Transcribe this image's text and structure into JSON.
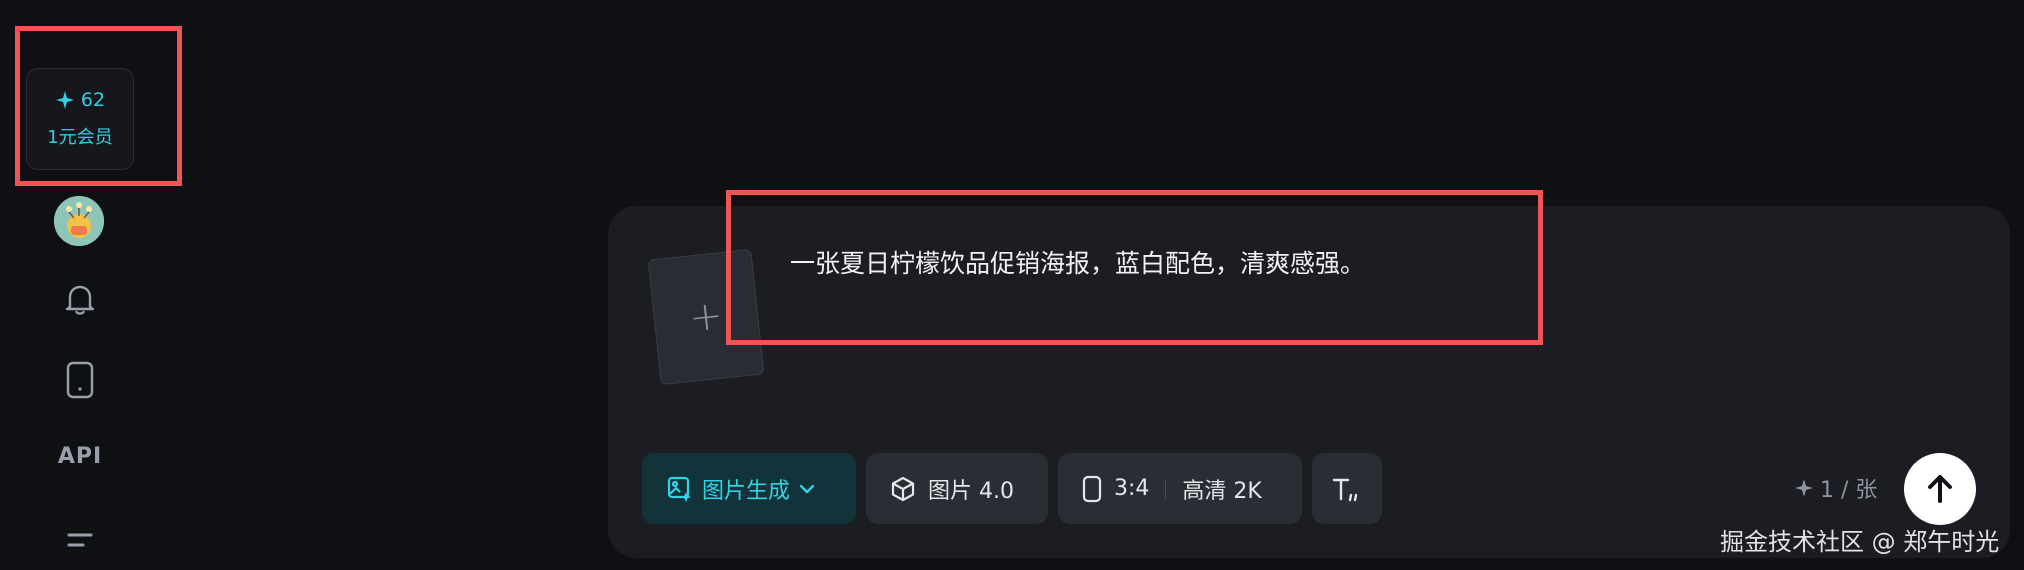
{
  "sidebar": {
    "credits": {
      "count": "62",
      "member_label": "1元会员",
      "accent_color": "#33cfe3"
    },
    "api_label": "API",
    "icons": [
      "user-avatar",
      "bell-icon",
      "device-icon",
      "menu-icon"
    ]
  },
  "composer": {
    "prompt": "一张夏日柠檬饮品促销海报，蓝白配色，清爽感强。",
    "upload_symbol": "+",
    "toolbar": {
      "mode_label": "图片生成",
      "model_label": "图片 4.0",
      "ratio_label": "3:4",
      "quality_label": "高清 2K",
      "cost_label": "1 / 张"
    }
  },
  "watermark": "掘金技术社区 @ 郑午时光",
  "colors": {
    "background": "#0f1014",
    "panel": "#1c1d23",
    "accent": "#2ed3e6",
    "highlight": "#ef5555"
  }
}
